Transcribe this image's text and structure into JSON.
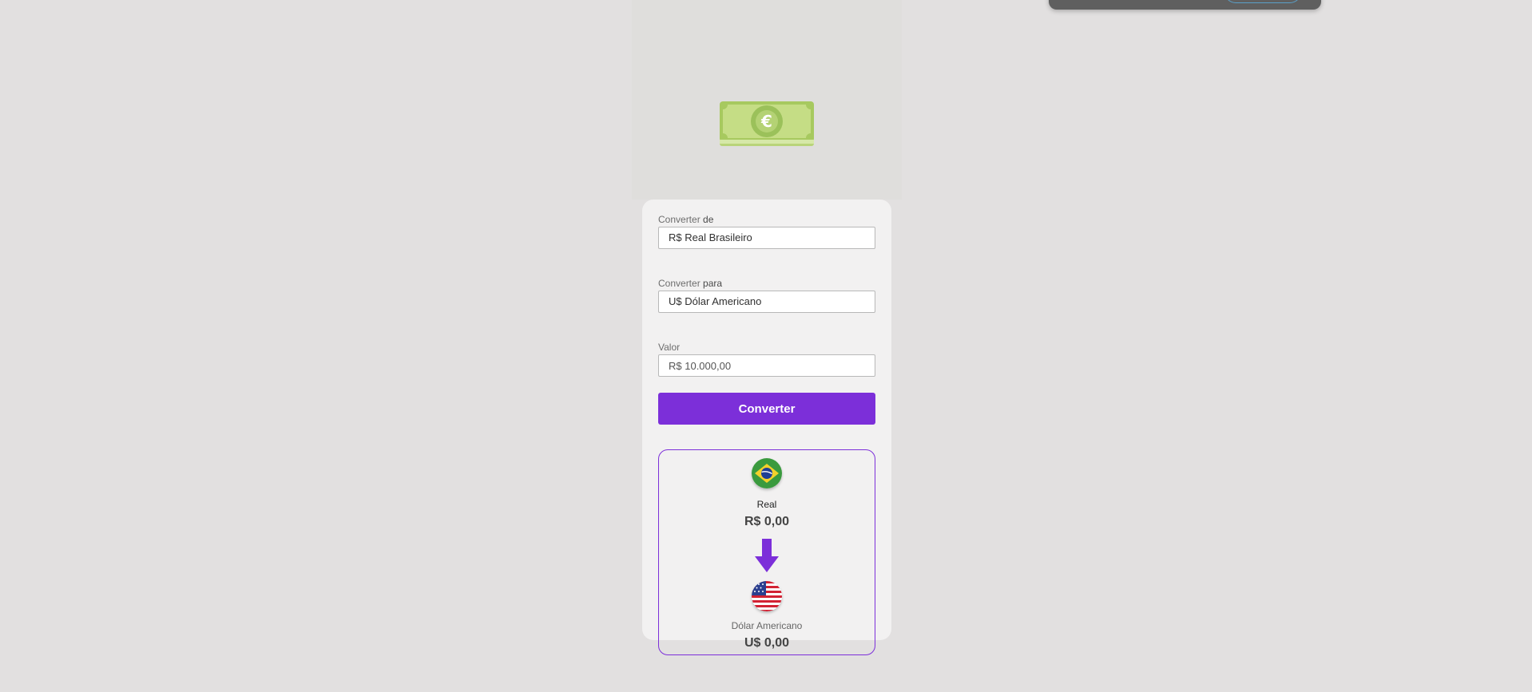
{
  "form": {
    "from_label_prefix": "Converter",
    "from_label_suffix": "de",
    "from_value": "R$ Real Brasileiro",
    "to_label_prefix": "Converter",
    "to_label_suffix": "para",
    "to_value": "U$ Dólar Americano",
    "amount_label": "Valor",
    "amount_placeholder": "R$ 10.000,00",
    "convert_label": "Converter"
  },
  "result": {
    "source_name": "Real",
    "source_value": "R$ 0,00",
    "target_name": "Dólar Americano",
    "target_value": "U$ 0,00"
  },
  "icons": {
    "hero": "euro-banknote-icon",
    "source_flag": "brazil-flag-icon",
    "arrow": "arrow-down-icon",
    "target_flag": "usa-flag-icon"
  },
  "colors": {
    "accent": "#7c2fd9",
    "background": "#e2e0e0",
    "card": "#f2f1f1"
  }
}
